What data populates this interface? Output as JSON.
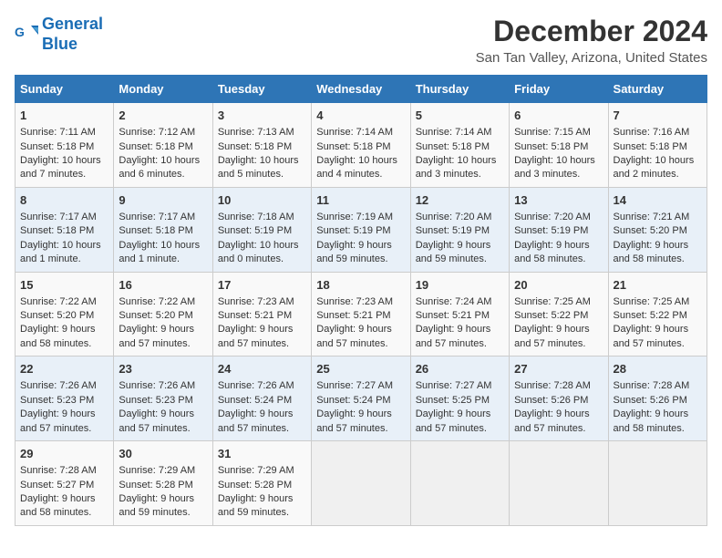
{
  "logo": {
    "line1": "General",
    "line2": "Blue"
  },
  "title": "December 2024",
  "subtitle": "San Tan Valley, Arizona, United States",
  "days_of_week": [
    "Sunday",
    "Monday",
    "Tuesday",
    "Wednesday",
    "Thursday",
    "Friday",
    "Saturday"
  ],
  "weeks": [
    [
      {
        "day": "1",
        "info": "Sunrise: 7:11 AM\nSunset: 5:18 PM\nDaylight: 10 hours and 7 minutes."
      },
      {
        "day": "2",
        "info": "Sunrise: 7:12 AM\nSunset: 5:18 PM\nDaylight: 10 hours and 6 minutes."
      },
      {
        "day": "3",
        "info": "Sunrise: 7:13 AM\nSunset: 5:18 PM\nDaylight: 10 hours and 5 minutes."
      },
      {
        "day": "4",
        "info": "Sunrise: 7:14 AM\nSunset: 5:18 PM\nDaylight: 10 hours and 4 minutes."
      },
      {
        "day": "5",
        "info": "Sunrise: 7:14 AM\nSunset: 5:18 PM\nDaylight: 10 hours and 3 minutes."
      },
      {
        "day": "6",
        "info": "Sunrise: 7:15 AM\nSunset: 5:18 PM\nDaylight: 10 hours and 3 minutes."
      },
      {
        "day": "7",
        "info": "Sunrise: 7:16 AM\nSunset: 5:18 PM\nDaylight: 10 hours and 2 minutes."
      }
    ],
    [
      {
        "day": "8",
        "info": "Sunrise: 7:17 AM\nSunset: 5:18 PM\nDaylight: 10 hours and 1 minute."
      },
      {
        "day": "9",
        "info": "Sunrise: 7:17 AM\nSunset: 5:18 PM\nDaylight: 10 hours and 1 minute."
      },
      {
        "day": "10",
        "info": "Sunrise: 7:18 AM\nSunset: 5:19 PM\nDaylight: 10 hours and 0 minutes."
      },
      {
        "day": "11",
        "info": "Sunrise: 7:19 AM\nSunset: 5:19 PM\nDaylight: 9 hours and 59 minutes."
      },
      {
        "day": "12",
        "info": "Sunrise: 7:20 AM\nSunset: 5:19 PM\nDaylight: 9 hours and 59 minutes."
      },
      {
        "day": "13",
        "info": "Sunrise: 7:20 AM\nSunset: 5:19 PM\nDaylight: 9 hours and 58 minutes."
      },
      {
        "day": "14",
        "info": "Sunrise: 7:21 AM\nSunset: 5:20 PM\nDaylight: 9 hours and 58 minutes."
      }
    ],
    [
      {
        "day": "15",
        "info": "Sunrise: 7:22 AM\nSunset: 5:20 PM\nDaylight: 9 hours and 58 minutes."
      },
      {
        "day": "16",
        "info": "Sunrise: 7:22 AM\nSunset: 5:20 PM\nDaylight: 9 hours and 57 minutes."
      },
      {
        "day": "17",
        "info": "Sunrise: 7:23 AM\nSunset: 5:21 PM\nDaylight: 9 hours and 57 minutes."
      },
      {
        "day": "18",
        "info": "Sunrise: 7:23 AM\nSunset: 5:21 PM\nDaylight: 9 hours and 57 minutes."
      },
      {
        "day": "19",
        "info": "Sunrise: 7:24 AM\nSunset: 5:21 PM\nDaylight: 9 hours and 57 minutes."
      },
      {
        "day": "20",
        "info": "Sunrise: 7:25 AM\nSunset: 5:22 PM\nDaylight: 9 hours and 57 minutes."
      },
      {
        "day": "21",
        "info": "Sunrise: 7:25 AM\nSunset: 5:22 PM\nDaylight: 9 hours and 57 minutes."
      }
    ],
    [
      {
        "day": "22",
        "info": "Sunrise: 7:26 AM\nSunset: 5:23 PM\nDaylight: 9 hours and 57 minutes."
      },
      {
        "day": "23",
        "info": "Sunrise: 7:26 AM\nSunset: 5:23 PM\nDaylight: 9 hours and 57 minutes."
      },
      {
        "day": "24",
        "info": "Sunrise: 7:26 AM\nSunset: 5:24 PM\nDaylight: 9 hours and 57 minutes."
      },
      {
        "day": "25",
        "info": "Sunrise: 7:27 AM\nSunset: 5:24 PM\nDaylight: 9 hours and 57 minutes."
      },
      {
        "day": "26",
        "info": "Sunrise: 7:27 AM\nSunset: 5:25 PM\nDaylight: 9 hours and 57 minutes."
      },
      {
        "day": "27",
        "info": "Sunrise: 7:28 AM\nSunset: 5:26 PM\nDaylight: 9 hours and 57 minutes."
      },
      {
        "day": "28",
        "info": "Sunrise: 7:28 AM\nSunset: 5:26 PM\nDaylight: 9 hours and 58 minutes."
      }
    ],
    [
      {
        "day": "29",
        "info": "Sunrise: 7:28 AM\nSunset: 5:27 PM\nDaylight: 9 hours and 58 minutes."
      },
      {
        "day": "30",
        "info": "Sunrise: 7:29 AM\nSunset: 5:28 PM\nDaylight: 9 hours and 59 minutes."
      },
      {
        "day": "31",
        "info": "Sunrise: 7:29 AM\nSunset: 5:28 PM\nDaylight: 9 hours and 59 minutes."
      },
      {
        "day": "",
        "info": ""
      },
      {
        "day": "",
        "info": ""
      },
      {
        "day": "",
        "info": ""
      },
      {
        "day": "",
        "info": ""
      }
    ]
  ]
}
